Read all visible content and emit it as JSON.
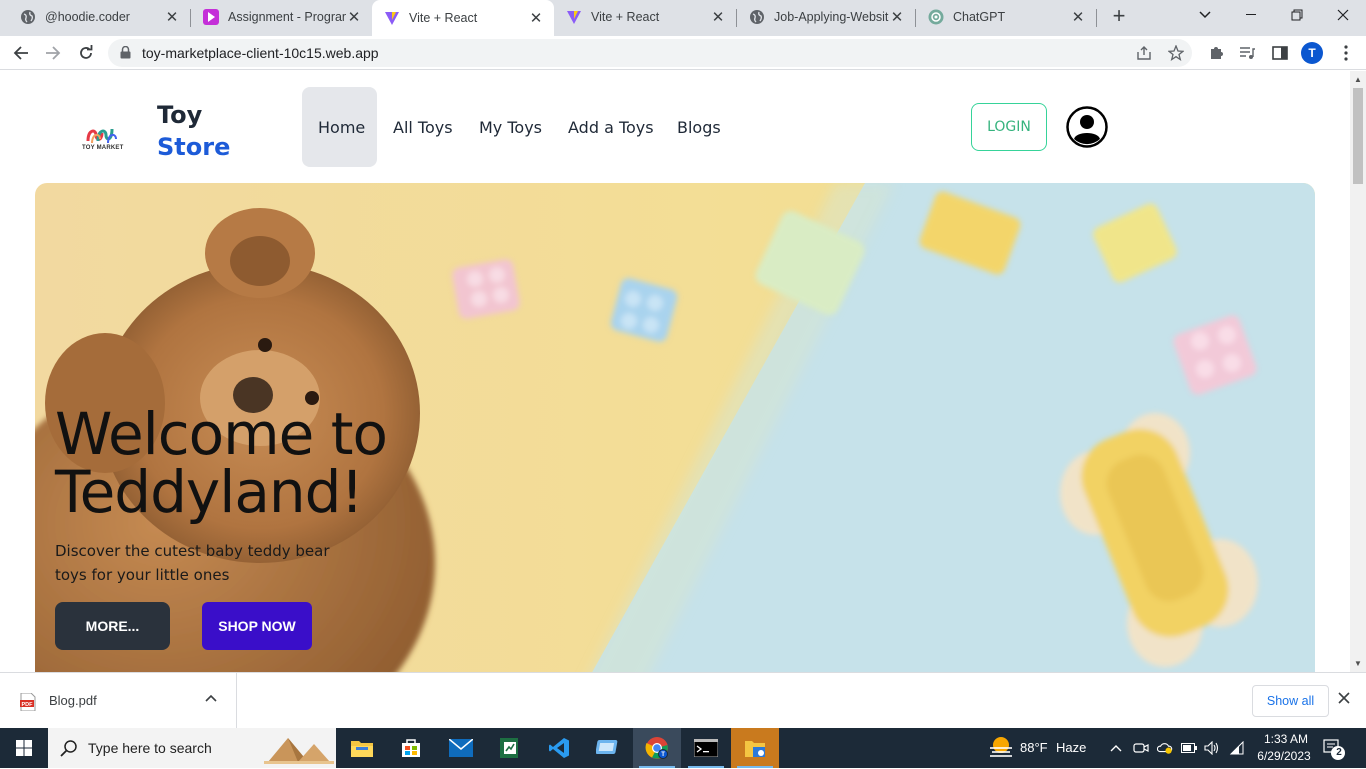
{
  "browser": {
    "tabs": [
      {
        "title": "@hoodie.coder",
        "icon": "globe-icon",
        "active": false
      },
      {
        "title": "Assignment - Programming Hero",
        "icon": "programming-hero-icon",
        "active": false
      },
      {
        "title": "Vite + React",
        "icon": "vite-icon",
        "active": true
      },
      {
        "title": "Vite + React",
        "icon": "vite-icon",
        "active": false
      },
      {
        "title": "Job-Applying-Website",
        "icon": "globe-icon",
        "active": false
      },
      {
        "title": "ChatGPT",
        "icon": "chatgpt-icon",
        "active": false
      }
    ],
    "url": "toy-marketplace-client-10c15.web.app",
    "profile_initial": "T"
  },
  "page": {
    "logo_caption": "TOY MARKET",
    "brand_line1": "Toy",
    "brand_line2": "Store",
    "nav": [
      {
        "label": "Home",
        "active": true
      },
      {
        "label": "All Toys",
        "active": false
      },
      {
        "label": "My Toys",
        "active": false
      },
      {
        "label": "Add a Toys",
        "active": false
      },
      {
        "label": "Blogs",
        "active": false
      }
    ],
    "login_label": "LOGIN",
    "hero": {
      "title": "Welcome to Teddyland!",
      "subtitle": "Discover the cutest baby teddy bear toys for your little ones",
      "more_label": "MORE...",
      "shop_label": "SHOP NOW"
    },
    "colors": {
      "brand_blue": "#1d5bd8",
      "login_green": "#36d399",
      "shop_purple": "#3a0ec9",
      "more_dark": "#2a323c"
    }
  },
  "downloads": {
    "file_name": "Blog.pdf",
    "show_all_label": "Show all"
  },
  "taskbar": {
    "search_placeholder": "Type here to search",
    "weather_temp": "88°F",
    "weather_desc": "Haze",
    "time": "1:33 AM",
    "date": "6/29/2023",
    "notification_count": "2"
  }
}
